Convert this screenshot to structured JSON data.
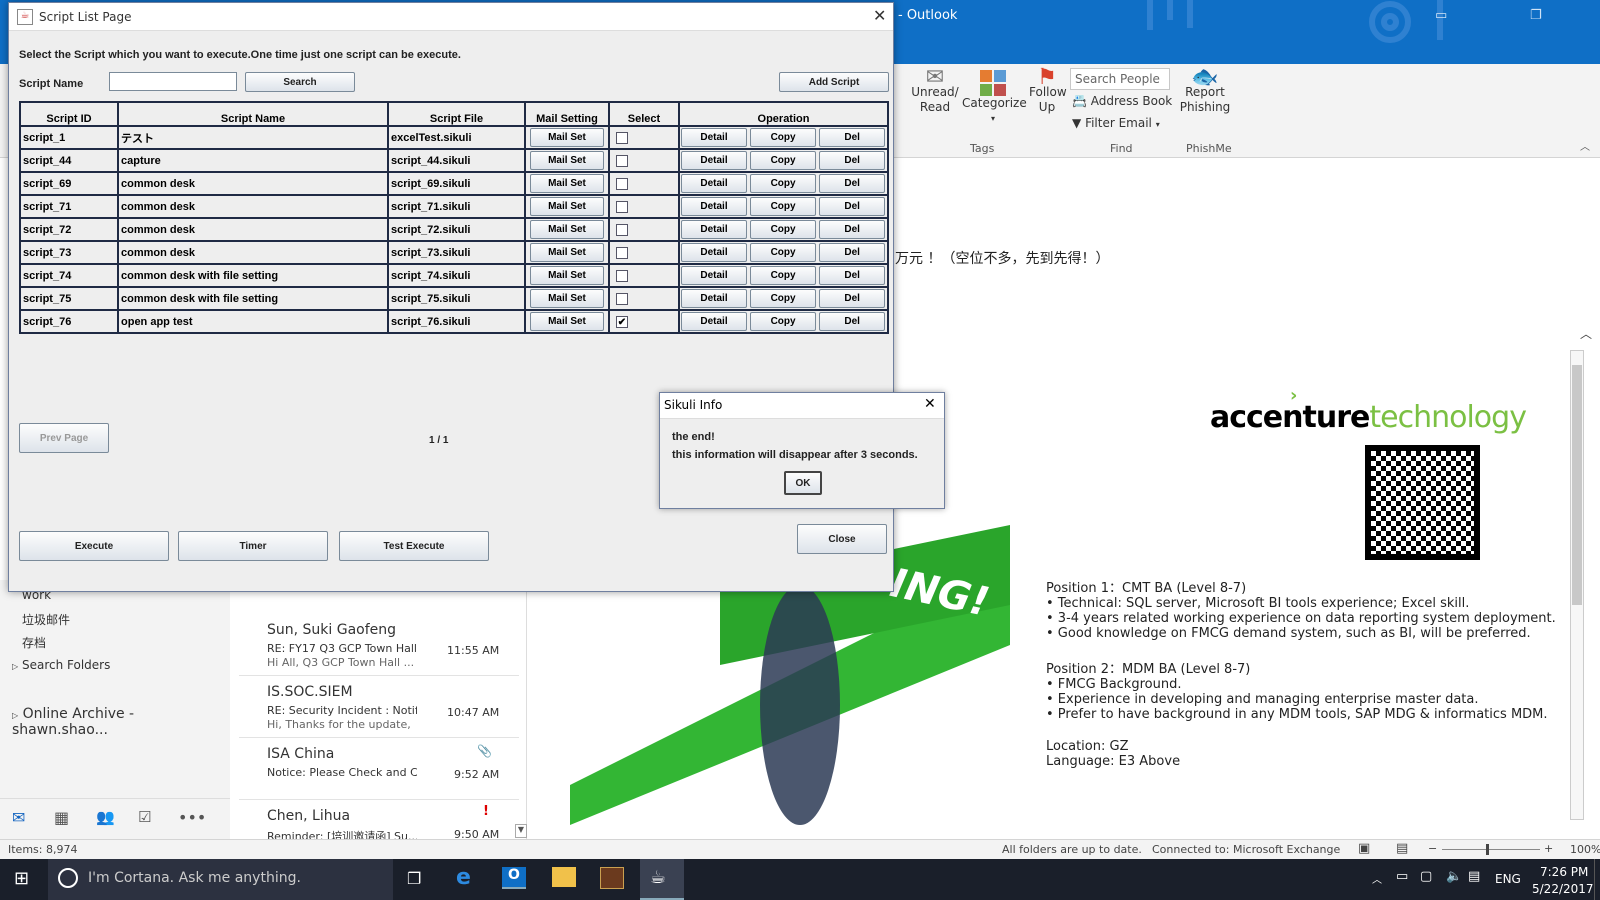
{
  "outlook": {
    "title": "- Outlook",
    "ribbon": {
      "unread_read": "Unread/ Read",
      "categorize": "Categorize",
      "follow_up": "Follow Up",
      "group_tags": "Tags",
      "search_people_placeholder": "Search People",
      "address_book": "Address Book",
      "filter_email": "Filter Email",
      "group_find": "Find",
      "report_phishing": "Report Phishing",
      "group_phishme": "PhishMe"
    },
    "header_text": "万元 ！（空位不多，先到先得！）",
    "nav": {
      "items": [
        "work",
        "垃圾邮件",
        "存档",
        "Search Folders"
      ],
      "archive": "Online Archive - shawn.shao..."
    },
    "mails": [
      {
        "from": "Sun, Suki Gaofeng",
        "subject": "RE: FY17 Q3 GCP Town Hall ...",
        "preview": "Hi All,  Q3 GCP Town Hall ...",
        "time": "11:55 AM"
      },
      {
        "from": "IS.SOC.SIEM",
        "subject": "RE: Security Incident : Notif...",
        "preview": "Hi,  Thanks for the update,",
        "time": "10:47 AM"
      },
      {
        "from": "ISA China",
        "subject": "Notice: Please Check and C...",
        "preview": "",
        "time": "9:52 AM"
      },
      {
        "from": "Chen, Lihua",
        "subject": "Reminder: [培训邀请函] Su...",
        "preview": "",
        "time": "9:50 AM"
      }
    ],
    "reading": {
      "brand_a": "accenture",
      "brand_b": "technology",
      "banner_text": "ING!",
      "lines": [
        "Position 1：CMT BA (Level 8-7)",
        "• Technical: SQL server, Microsoft BI tools experience; Excel skill.",
        "• 3-4 years related working experience on data reporting system deployment.",
        "• Good knowledge on FMCG demand system, such as BI, will be preferred.",
        "",
        "Position 2：MDM BA (Level 8-7)",
        "• FMCG Background.",
        "• Experience in developing and managing enterprise master data.",
        "• Prefer to have background in any MDM tools, SAP MDG & informatics MDM.",
        "",
        "Location: GZ",
        "Language: E3 Above"
      ]
    },
    "status": {
      "items": "Items: 8,974",
      "sync": "All folders are up to date.",
      "connected": "Connected to: Microsoft Exchange",
      "zoom": "100%"
    }
  },
  "taskbar": {
    "cortana": "I'm Cortana. Ask me anything.",
    "lang": "ENG",
    "time": "7:26 PM",
    "date": "5/22/2017"
  },
  "script_window": {
    "title": "Script List Page",
    "instruction": "Select the Script which you want to execute.One time just one script can be execute.",
    "script_name_label": "Script Name",
    "search_value": "",
    "search_button": "Search",
    "add_button": "Add Script",
    "columns": [
      "Script ID",
      "Script Name",
      "Script File",
      "Mail Setting",
      "Select",
      "Operation"
    ],
    "mail_set_label": "Mail Set",
    "detail_label": "Detail",
    "copy_label": "Copy",
    "del_label": "Del",
    "rows": [
      {
        "id": "script_1",
        "name": "テスト",
        "file": "excelTest.sikuli",
        "selected": false
      },
      {
        "id": "script_44",
        "name": "capture",
        "file": "script_44.sikuli",
        "selected": false
      },
      {
        "id": "script_69",
        "name": "common desk",
        "file": "script_69.sikuli",
        "selected": false
      },
      {
        "id": "script_71",
        "name": "common desk",
        "file": "script_71.sikuli",
        "selected": false
      },
      {
        "id": "script_72",
        "name": "common desk",
        "file": "script_72.sikuli",
        "selected": false
      },
      {
        "id": "script_73",
        "name": "common desk",
        "file": "script_73.sikuli",
        "selected": false
      },
      {
        "id": "script_74",
        "name": "common desk with file setting",
        "file": "script_74.sikuli",
        "selected": false
      },
      {
        "id": "script_75",
        "name": "common desk with file setting",
        "file": "script_75.sikuli",
        "selected": false
      },
      {
        "id": "script_76",
        "name": "open app test",
        "file": "script_76.sikuli",
        "selected": true
      }
    ],
    "prev_page": "Prev Page",
    "page_indicator": "1 / 1",
    "execute": "Execute",
    "timer": "Timer",
    "test_execute": "Test Execute",
    "close": "Close"
  },
  "sikuli_dialog": {
    "title": "Sikuli Info",
    "line1": "the end!",
    "line2": "this information will disappear after 3 seconds.",
    "ok": "OK"
  }
}
